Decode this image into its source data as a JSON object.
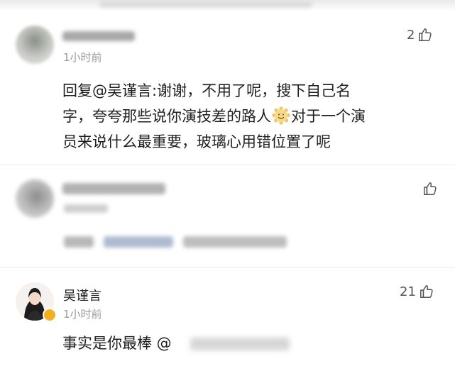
{
  "comments": [
    {
      "time": "1小时前",
      "likes": "2",
      "text": {
        "prefix": "回复",
        "mention": "@吴谨言",
        "line1_rest": ":谢谢，不用了呢，搜下自己名",
        "line2_before_emoji": "字，夸夸那些说你演技差的路人",
        "line2_after_emoji": "对于一个演",
        "line3": "员来说什么最重要，玻璃心用错位置了呢"
      }
    },
    {
      "likes": ""
    },
    {
      "name": "吴谨言",
      "time": "1小时前",
      "likes": "21",
      "text_prefix": "事实是你最棒 @"
    }
  ],
  "colors": {
    "verified_badge": "#f2b01e",
    "secondary_text": "#9a9a9a",
    "divider": "#ececec"
  },
  "icons": {
    "like": "thumbs-up-icon",
    "emoji": "smiling-face-icon",
    "verified": "verified-badge-icon"
  }
}
